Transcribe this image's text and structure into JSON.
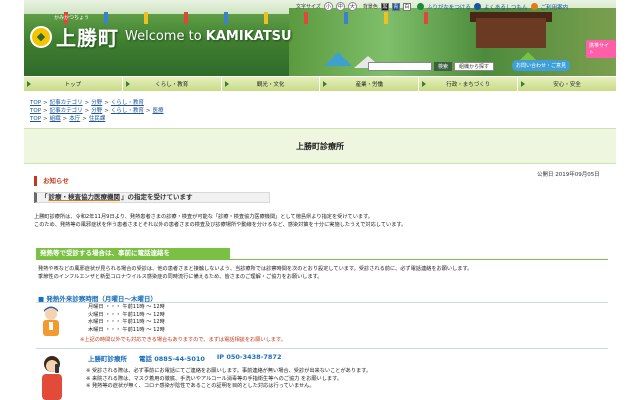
{
  "header": {
    "logo_ruby": "かみかつちょう",
    "logo_jp": "上勝町",
    "logo_en_prefix": "Welcome to ",
    "logo_en_name": "KAMIKATSU",
    "toolbar": {
      "font_size_label": "文字サイズ",
      "font_sizes": [
        "小",
        "中",
        "大"
      ],
      "bg_color_label": "背景色",
      "bg_colors": [
        {
          "label": "黒",
          "color": "#222222"
        },
        {
          "label": "青",
          "color": "#1a55a0"
        },
        {
          "label": "白",
          "color": "#ffffff"
        }
      ],
      "furigana_label": "ふりがなをつける",
      "faq_label": "よくあるしつもん",
      "usage_label": "ご利用案内"
    },
    "search": {
      "button_label": "検索",
      "advanced_label": "組織から探す"
    },
    "badge_ikisho": "携帯サイト",
    "badge_furusato": "お問い合わせ・ご意見"
  },
  "nav": [
    "トップ",
    "くらし・教育",
    "観光・文化",
    "産業・労働",
    "行政・まちづくり",
    "安心・安全"
  ],
  "breadcrumbs": [
    [
      "TOP",
      "記事カテゴリ",
      "分野",
      "くらし・教育"
    ],
    [
      "TOP",
      "記事カテゴリ",
      "分野",
      "くらし・教育",
      "医療"
    ],
    [
      "TOP",
      "組織",
      "本庁",
      "住民課"
    ]
  ],
  "page": {
    "title": "上勝町診療所",
    "published": "公開日 2019年09月05日"
  },
  "notice": {
    "heading": "お知らせ",
    "bar_open": "「",
    "bar_underlined": "診療・検査協力医療機関",
    "bar_close": "」の指定を受けています",
    "para1": "上勝町診療所は、令和2年11月9日より、発熱患者さまの診療・検査が可能な「診療・検査協力医療機関」として徳島県より指定を受けています。",
    "para2": "このため、発熱等の風邪症状を伴う患者さまとそれ以外の患者さまの検査及び診療場所や動線を分けるなど、感染対策を十分に実施したうえで対応しています。"
  },
  "fever": {
    "bar": "発熱等で受診する場合は、事前に電話連絡を",
    "para1": "発熱や咳などの風邪症状が見られる場合の受診は、他の患者さまと接触しないよう、当診療所では診察時間を次のとおり設定しています。受診される前に、必ず電話連絡をお願いします。",
    "para2": "季節性のインフルエンザと新型コロナウイルス感染症の同時流行に備えるため、皆さまのご理解・ご協力をお願いします。",
    "hours_heading": "発熱外来診察時間（月曜日～木曜日）",
    "hours": [
      "月曜日 ・・・ 午前11時 ～ 12時",
      "火曜日 ・・・ 午前11時 ～ 12時",
      "水曜日 ・・・ 午前11時 ～ 12時",
      "木曜日 ・・・ 午前11時 ～ 12時"
    ],
    "hours_note": "※上記の時間以外でも対応できる場合もありますので、まずは電話相談をお願いします。",
    "contact_name": "上勝町診療所",
    "contact_tel": "電話 0885-44-5010",
    "contact_ip": "IP 050-3438-7872",
    "bullets": [
      "※ 受診される際は、必ず事前にお電話にてご連絡をお願いします。事前連絡が無い場合、受診が出来ないことがあります。",
      "※ 来院される際は、マスク着用の徹底、手洗いやアルコール消毒等の手指衛生等へのご協力 をお願いします。",
      "※ 発熱等の症状が無く、コロナ感染が陰性であることの証明を目的とした対応は行っていません。"
    ]
  },
  "colors": {
    "accent_green": "#7ac043",
    "heading_red": "#c03a1a",
    "link_blue": "#1a55a0"
  }
}
